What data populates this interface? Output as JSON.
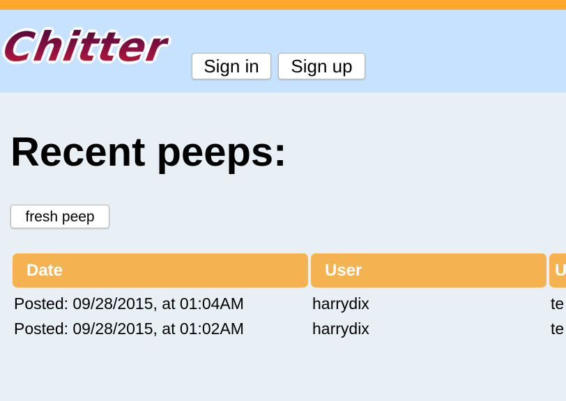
{
  "header": {
    "logo_text": "Chitter",
    "signin_label": "Sign in",
    "signup_label": "Sign up"
  },
  "main": {
    "title": "Recent peeps:",
    "fresh_peep_label": "fresh peep"
  },
  "table": {
    "columns": [
      "Date",
      "User",
      "U"
    ],
    "rows": [
      {
        "date": "Posted: 09/28/2015, at 01:04AM",
        "user": "harrydix",
        "third": "te"
      },
      {
        "date": "Posted: 09/28/2015, at 01:02AM",
        "user": "harrydix",
        "third": "te"
      }
    ]
  },
  "colors": {
    "top_stripe": "#ffa62b",
    "header_bg": "#c6e2ff",
    "page_bg": "#e8f0f5",
    "table_header_bg": "#f4b350",
    "logo_color": "#8a1040"
  }
}
